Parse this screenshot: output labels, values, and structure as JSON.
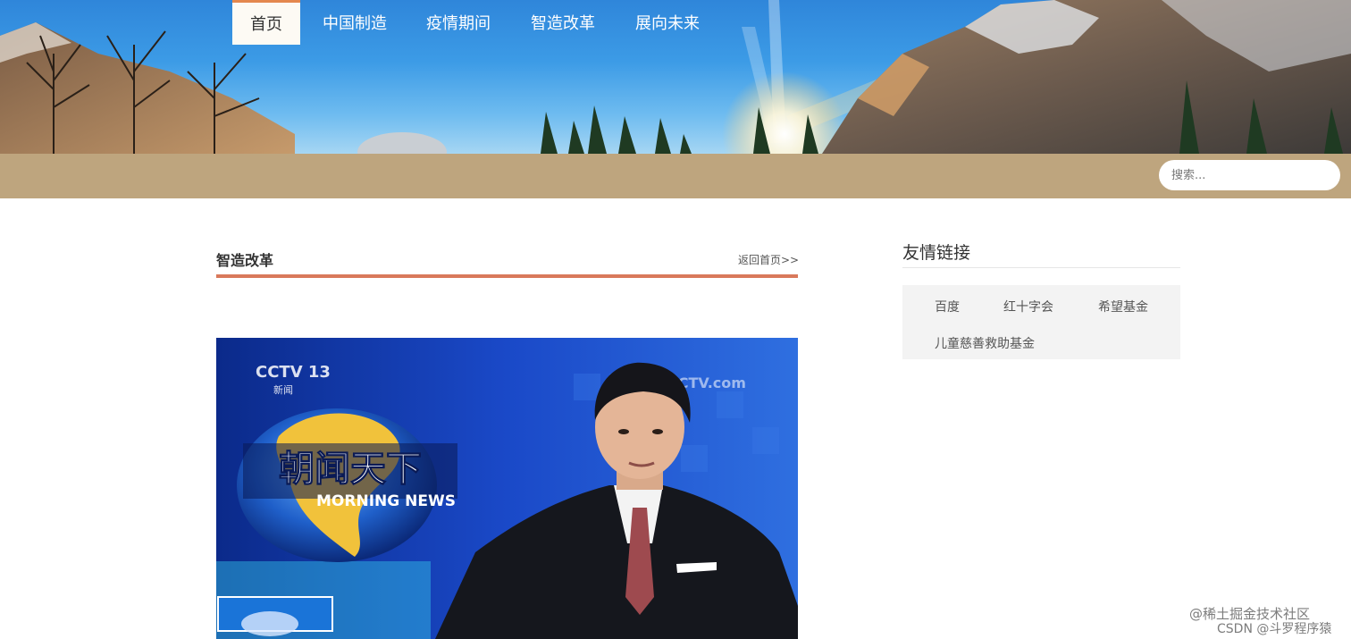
{
  "nav": {
    "items": [
      "首页",
      "中国制造",
      "疫情期间",
      "智造改革",
      "展向未来"
    ],
    "active_index": 0
  },
  "search": {
    "placeholder": "搜索..."
  },
  "main": {
    "section_title": "智造改革",
    "back_link": "返回首页>>",
    "news_image": {
      "channel_logo": "CCTV 13",
      "channel_sub": "新闻",
      "watermark": "CCTV.com",
      "program_title": "朝闻天下",
      "program_en": "MORNING NEWS"
    }
  },
  "sidebar": {
    "title": "友情链接",
    "links": [
      "百度",
      "红十字会",
      "希望基金",
      "儿童慈善救助基金"
    ]
  },
  "watermark": {
    "line1": "@稀土掘金技术社区",
    "line2": "CSDN @斗罗程序猿"
  },
  "colors": {
    "nav_bg": "#bea57e",
    "nav_active_border": "#e4874e",
    "section_rule": "#d9795b",
    "links_box_bg": "#f3f3f3"
  }
}
